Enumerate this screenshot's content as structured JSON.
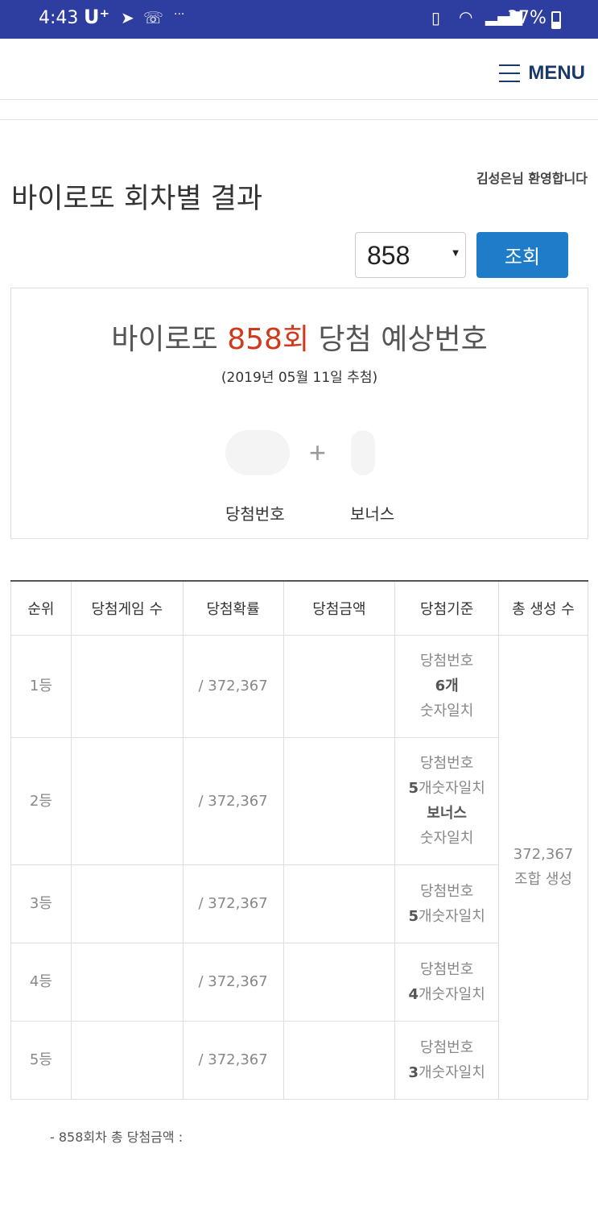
{
  "status_bar": {
    "time": "4:43",
    "carrier": "U⁺",
    "battery": "37%",
    "battery_level_pct": 37,
    "icons": [
      "send-icon",
      "phone-icon",
      "more-icon",
      "vibrate-icon",
      "wifi-icon",
      "signal-icon",
      "battery-icon"
    ]
  },
  "header": {
    "menu_label": "MENU"
  },
  "welcome": "김성은님 환영합니다",
  "page_title": "바이로또 회차별 결과",
  "search": {
    "round_value": "858",
    "button_label": "조회"
  },
  "result": {
    "title_prefix": "바이로또 ",
    "title_round": "858회",
    "title_suffix": " 당첨 예상번호",
    "date": "(2019년 05월 11일 추첨)",
    "plus": "+",
    "main_label": "당첨번호",
    "bonus_label": "보너스"
  },
  "table": {
    "headers": [
      "순위",
      "당첨게임 수",
      "당첨확률",
      "당첨금액",
      "당첨기준",
      "총 생성 수"
    ],
    "rows": [
      {
        "rank": "1등",
        "games": "",
        "prob": "/ 372,367",
        "amount": "",
        "crit_1": "당첨번호",
        "crit_2b": "6",
        "crit_2": "개",
        "crit_3": "숫자일치",
        "crit_4": ""
      },
      {
        "rank": "2등",
        "games": "",
        "prob": "/ 372,367",
        "amount": "",
        "crit_1": "당첨번호",
        "crit_2b": "5",
        "crit_2": "개숫자일치",
        "crit_3": "보너스",
        "crit_4": "숫자일치"
      },
      {
        "rank": "3등",
        "games": "",
        "prob": "/ 372,367",
        "amount": "",
        "crit_1": "당첨번호",
        "crit_2b": "5",
        "crit_2": "개숫자일치"
      },
      {
        "rank": "4등",
        "games": "",
        "prob": "/ 372,367",
        "amount": "",
        "crit_1": "당첨번호",
        "crit_2b": "4",
        "crit_2": "개숫자일치"
      },
      {
        "rank": "5등",
        "games": "",
        "prob": "/ 372,367",
        "amount": "",
        "crit_1": "당첨번호",
        "crit_2b": "3",
        "crit_2": "개숫자일치"
      }
    ],
    "total_count": "372,367",
    "total_label": "조합 생성"
  },
  "note": "- 858회차 총 당첨금액 :"
}
